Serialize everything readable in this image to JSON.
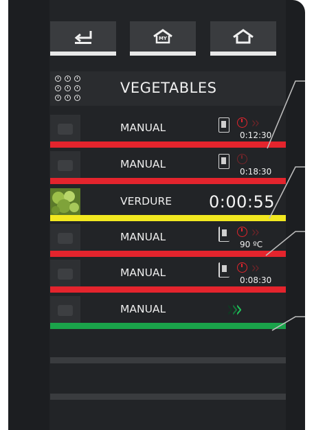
{
  "nav": {
    "back": {
      "icon": "back-arrow-icon"
    },
    "my": {
      "icon": "my-home-icon",
      "badge": "MY"
    },
    "home": {
      "icon": "home-icon"
    }
  },
  "header": {
    "title": "VEGETABLES",
    "icon": "dials-icon"
  },
  "rows": [
    {
      "label": "MANUAL",
      "value": "0:12:30",
      "status": "red",
      "icons": [
        "camera-icon",
        "clock-icon"
      ]
    },
    {
      "label": "MANUAL",
      "value": "0:18:30",
      "status": "red",
      "icons": [
        "camera-icon",
        "clock-icon"
      ]
    },
    {
      "label": "VERDURE",
      "value": "0:00:55",
      "status": "yellow",
      "icons": [
        "vegetable-thumbnail"
      ]
    },
    {
      "label": "MANUAL",
      "value": "90 ºC",
      "status": "red",
      "icons": [
        "camera-icon",
        "clock-icon"
      ]
    },
    {
      "label": "MANUAL",
      "value": "0:08:30",
      "status": "red",
      "icons": [
        "camera-icon",
        "clock-icon"
      ]
    },
    {
      "label": "MANUAL",
      "value": "",
      "status": "green",
      "icons": [
        "start-chevrons-icon"
      ]
    }
  ],
  "colors": {
    "red": "#e4242d",
    "yellow": "#f2e820",
    "green": "#1aa34a",
    "background": "#1c1e21"
  }
}
